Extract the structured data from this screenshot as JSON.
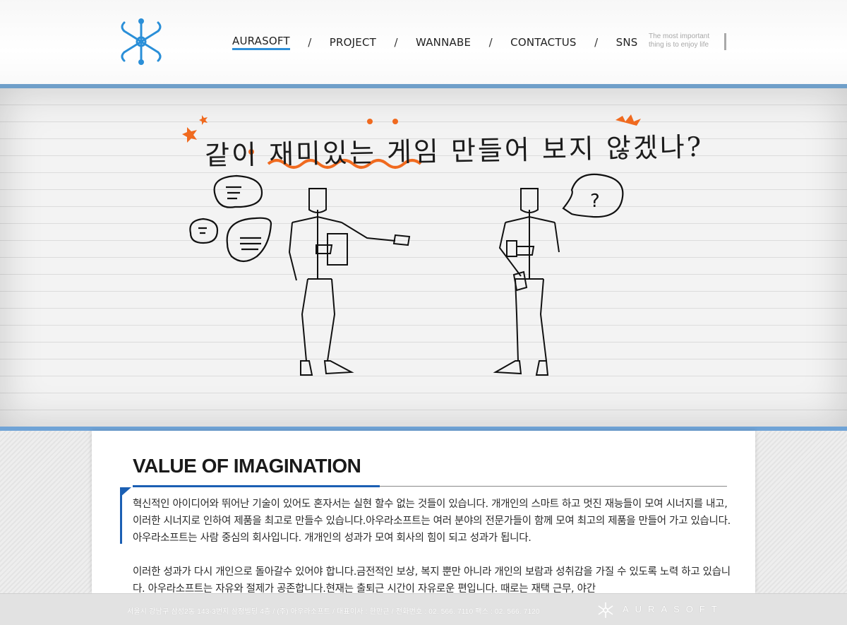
{
  "header": {
    "logo_icon": "molecule-logo-icon",
    "nav": [
      {
        "label": "AURASOFT",
        "active": true
      },
      {
        "label": "PROJECT",
        "active": false
      },
      {
        "label": "WANNABE",
        "active": false
      },
      {
        "label": "CONTACTUS",
        "active": false
      },
      {
        "label": "SNS",
        "active": false
      }
    ],
    "separator": "/",
    "tagline_line1": "The most important",
    "tagline_line2": "thing is to enjoy life"
  },
  "hero": {
    "title": "같이 재미있는 게임 만들어 보지 않겠나?",
    "speech_right": "?"
  },
  "content": {
    "title": "VALUE OF IMAGINATION",
    "paragraph1": "혁신적인 아이디어와 뛰어난 기술이 있어도 혼자서는 실현 할수 없는 것들이 있습니다.  개개인의 스마트 하고 멋진 재능들이 모여 시너지를 내고, 이러한 시너지로 인하여 제품을 최고로 만들수 있습니다.아우라소프트는 여러 분야의 전문가들이 함께 모여 최고의 제품을 만들어 가고 있습니다. 아우라소프트는 사람 중심의 회사입니다. 개개인의 성과가 모여 회사의 힘이 되고 성과가 됩니다.",
    "paragraph2": "이러한 성과가 다시 개인으로 돌아갈수 있어야 합니다.금전적인 보상, 복지 뿐만 아니라 개인의 보람과 성취감을 가질 수 있도록 노력 하고 있습니다. 아우라소프트는 자유와 절제가 공존합니다.현재는 출퇴근 시간이 자유로운 편입니다. 때로는 재택 근무, 야간"
  },
  "footer": {
    "address": "서울시 강남구 삼성2동 143-3번지 삼정빌딩 4층 / (주) 아우라소프트 / 대표이사 : 한만근 / 전화번호 : 02. 566. 7110  팩스 : 02. 566. 7120",
    "brand": "AURASOFT"
  },
  "colors": {
    "accent_blue": "#1b5fb3",
    "nav_underline": "#2f8fd8",
    "hero_border": "#6fa3d6",
    "orange_scribble": "#f06a1f"
  }
}
